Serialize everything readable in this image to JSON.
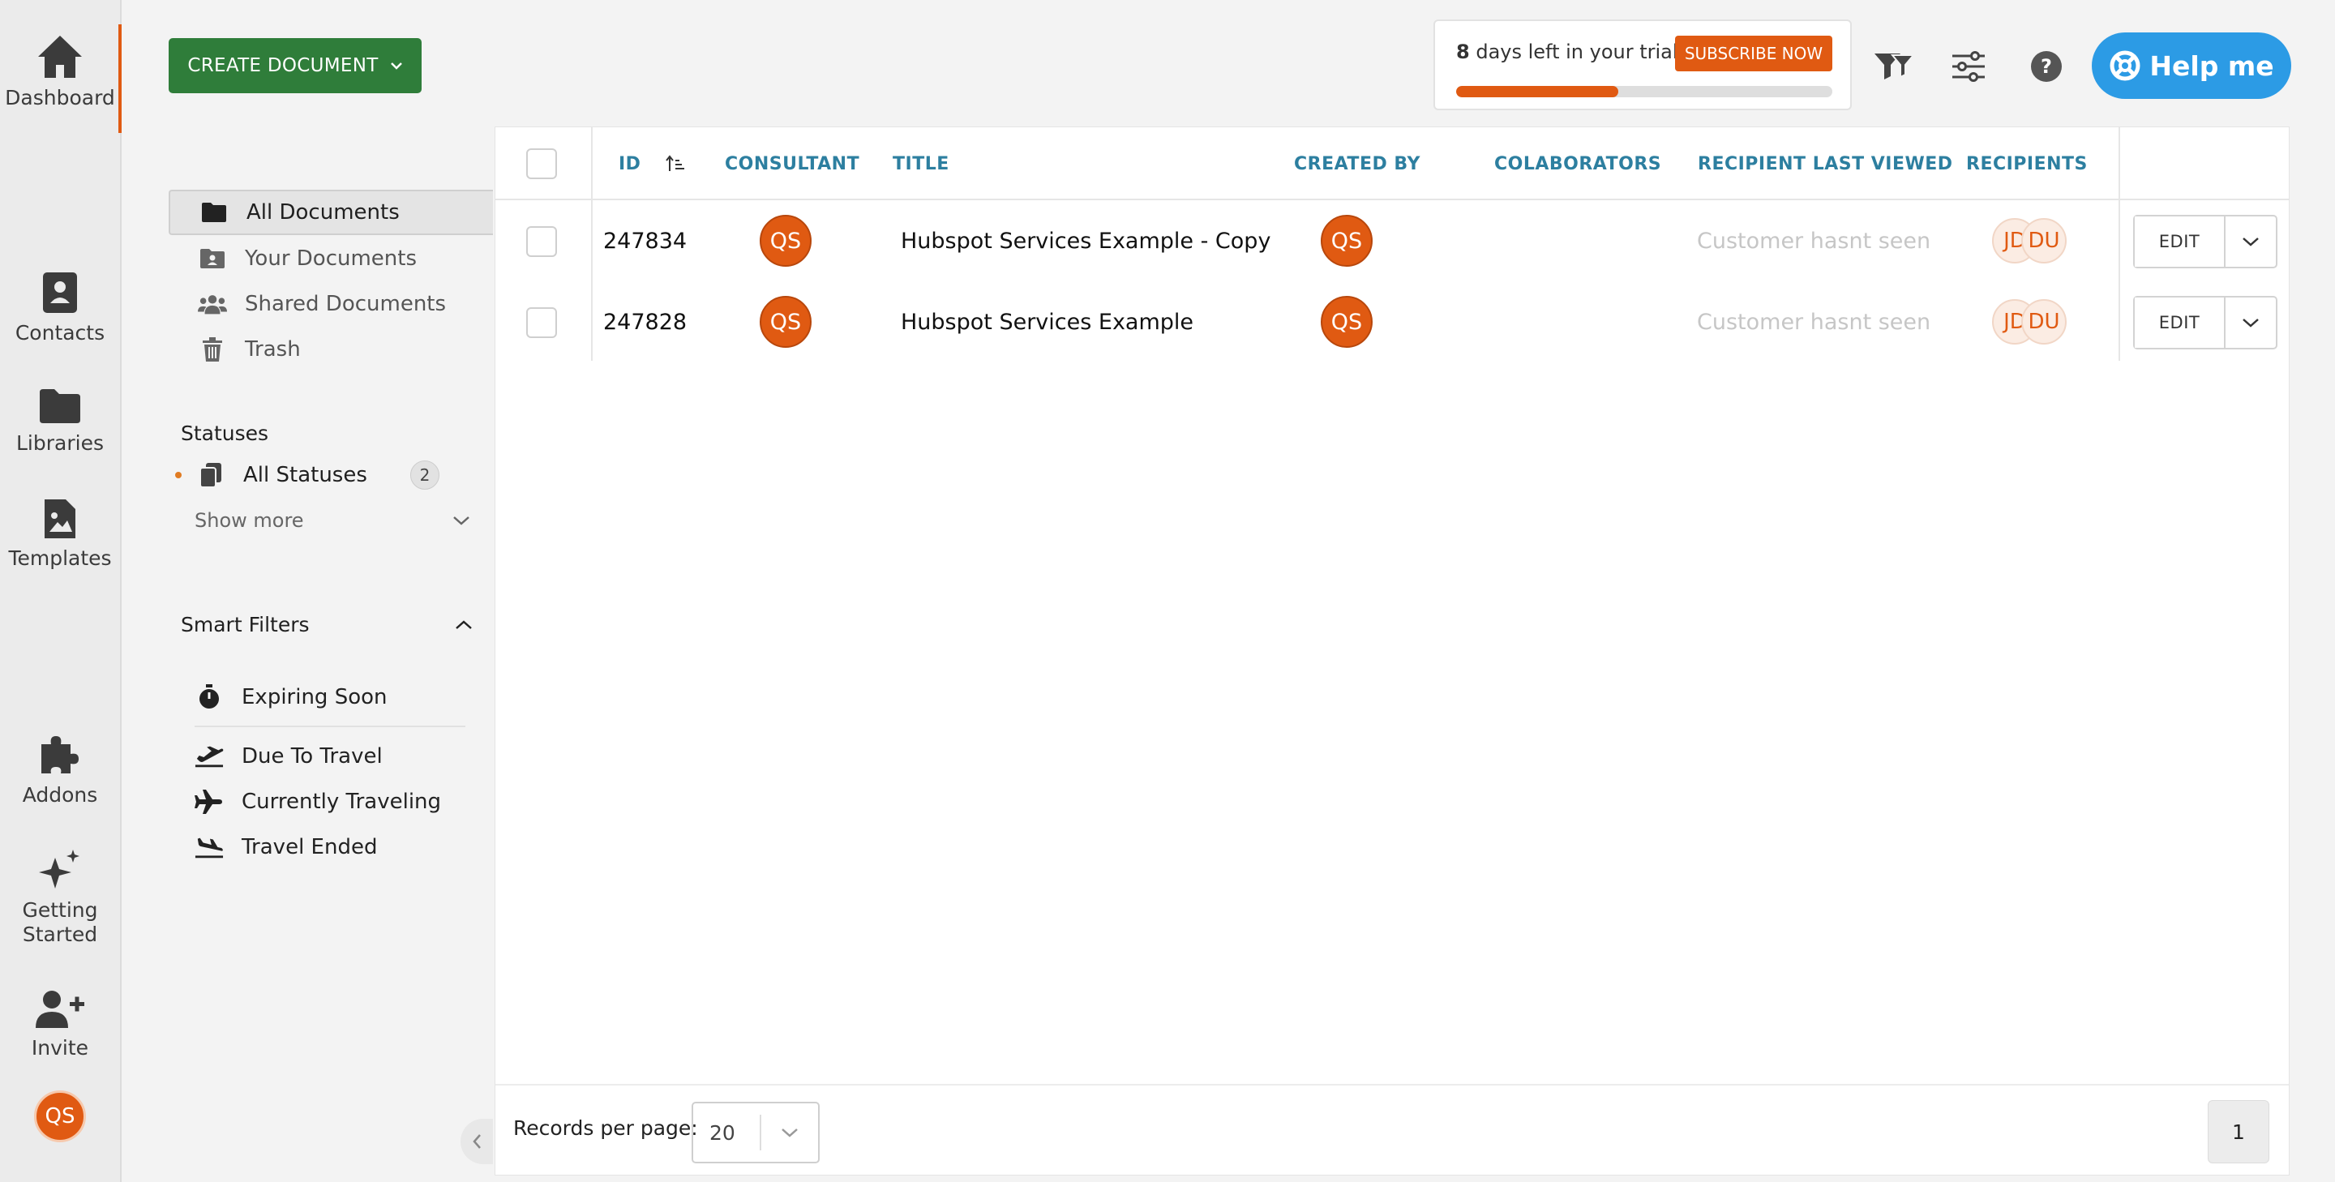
{
  "rail": {
    "items": [
      {
        "label": "Dashboard",
        "icon": "home-icon"
      },
      {
        "label": "Contacts",
        "icon": "contacts-icon"
      },
      {
        "label": "Libraries",
        "icon": "folder-icon"
      },
      {
        "label": "Templates",
        "icon": "template-image-icon"
      },
      {
        "label": "Addons",
        "icon": "puzzle-icon"
      },
      {
        "label": "Getting Started",
        "icon": "sparkle-icon"
      },
      {
        "label": "Invite",
        "icon": "user-plus-icon"
      }
    ],
    "avatar": "QS"
  },
  "toolbar": {
    "create_label": "CREATE DOCUMENT"
  },
  "nav": {
    "items": [
      {
        "label": "All Documents",
        "icon": "folder-icon"
      },
      {
        "label": "Your Documents",
        "icon": "user-folder-icon"
      },
      {
        "label": "Shared Documents",
        "icon": "users-icon"
      },
      {
        "label": "Trash",
        "icon": "trash-icon"
      }
    ]
  },
  "statuses": {
    "title": "Statuses",
    "all_label": "All Statuses",
    "all_count": "2",
    "show_more": "Show more"
  },
  "smart_filters": {
    "title": "Smart Filters",
    "items": [
      {
        "label": "Expiring Soon",
        "icon": "stopwatch-icon"
      },
      {
        "label": "Due To Travel",
        "icon": "plane-departure-icon"
      },
      {
        "label": "Currently Traveling",
        "icon": "plane-icon"
      },
      {
        "label": "Travel Ended",
        "icon": "plane-arrival-icon"
      }
    ]
  },
  "trial": {
    "days": "8",
    "text": "days left in your trial",
    "subscribe_label": "SUBSCRIBE NOW",
    "progress_fraction": 0.43,
    "accent": "#e05a12"
  },
  "help": {
    "label": "Help me"
  },
  "table": {
    "columns": {
      "id": "ID",
      "consultant": "CONSULTANT",
      "title": "TITLE",
      "created_by": "CREATED BY",
      "collaborators": "COLABORATORS",
      "last_viewed": "RECIPIENT LAST VIEWED",
      "recipients": "RECIPIENTS"
    },
    "rows": [
      {
        "id": "247834",
        "consultant": "QS",
        "title": "Hubspot Services Example - Copy",
        "created_by": "QS",
        "last_viewed": "Customer hasnt seen",
        "recipients": [
          "JD",
          "DU"
        ],
        "edit_label": "EDIT"
      },
      {
        "id": "247828",
        "consultant": "QS",
        "title": "Hubspot Services Example",
        "created_by": "QS",
        "last_viewed": "Customer hasnt seen",
        "recipients": [
          "JD",
          "DU"
        ],
        "edit_label": "EDIT"
      }
    ]
  },
  "footer": {
    "rpp_label": "Records per page:",
    "rpp_value": "20",
    "page": "1"
  }
}
